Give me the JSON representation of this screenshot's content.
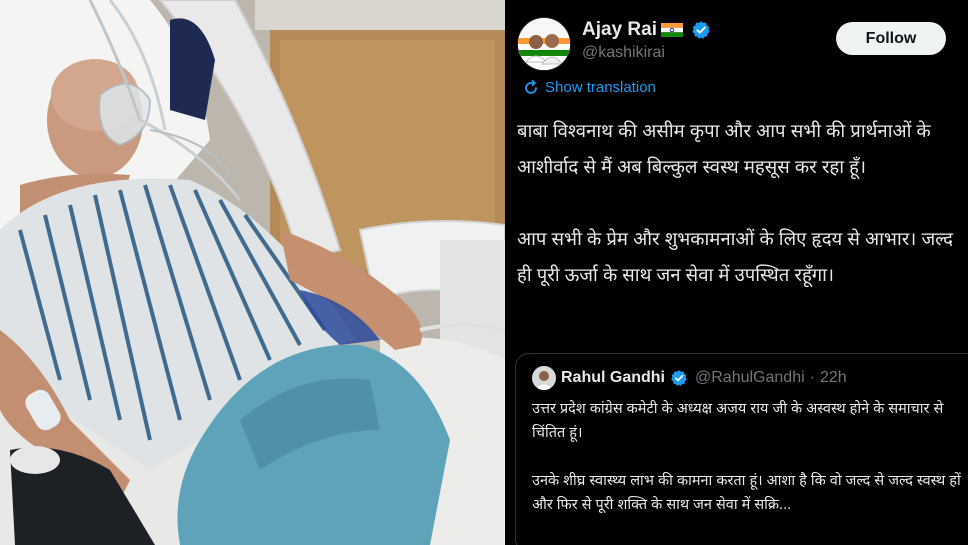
{
  "photo": {
    "description_icon": "hospital-patient-photo"
  },
  "tweet": {
    "author": {
      "display_name": "Ajay Rai",
      "handle": "@kashikirai",
      "flag_icon": "india-flag-icon",
      "verified_icon": "verified-badge-icon"
    },
    "follow_label": "Follow",
    "translate_label": "Show translation",
    "body": [
      "बाबा विश्वनाथ की असीम कृपा और आप सभी की प्रार्थनाओं के आशीर्वाद से मैं अब बिल्कुल स्वस्थ महसूस कर रहा हूँ।",
      "आप सभी के प्रेम और शुभकामनाओं के लिए हृदय से आभार। जल्द ही पूरी ऊर्जा के साथ जन सेवा में उपस्थित रहूँगा।"
    ],
    "quote": {
      "display_name": "Rahul Gandhi",
      "handle": "@RahulGandhi",
      "separator": "·",
      "time": "22h",
      "body": [
        "उत्तर प्रदेश कांग्रेस कमेटी के अध्यक्ष अजय राय जी के अस्वस्थ होने के समाचार से चिंतित हूं।",
        "उनके शीघ्र स्वास्थ्य लाभ की कामना करता हूं। आशा है कि वो जल्द से जल्द स्वस्थ हों और फिर से पूरी शक्ति के साथ जन सेवा में सक्रि..."
      ]
    }
  },
  "colors": {
    "background": "#000000",
    "text": "#e7e9ea",
    "secondary_text": "#71767b",
    "link": "#1d9bf0",
    "verified": "#1d9bf0",
    "follow_bg": "#eff3f4"
  }
}
